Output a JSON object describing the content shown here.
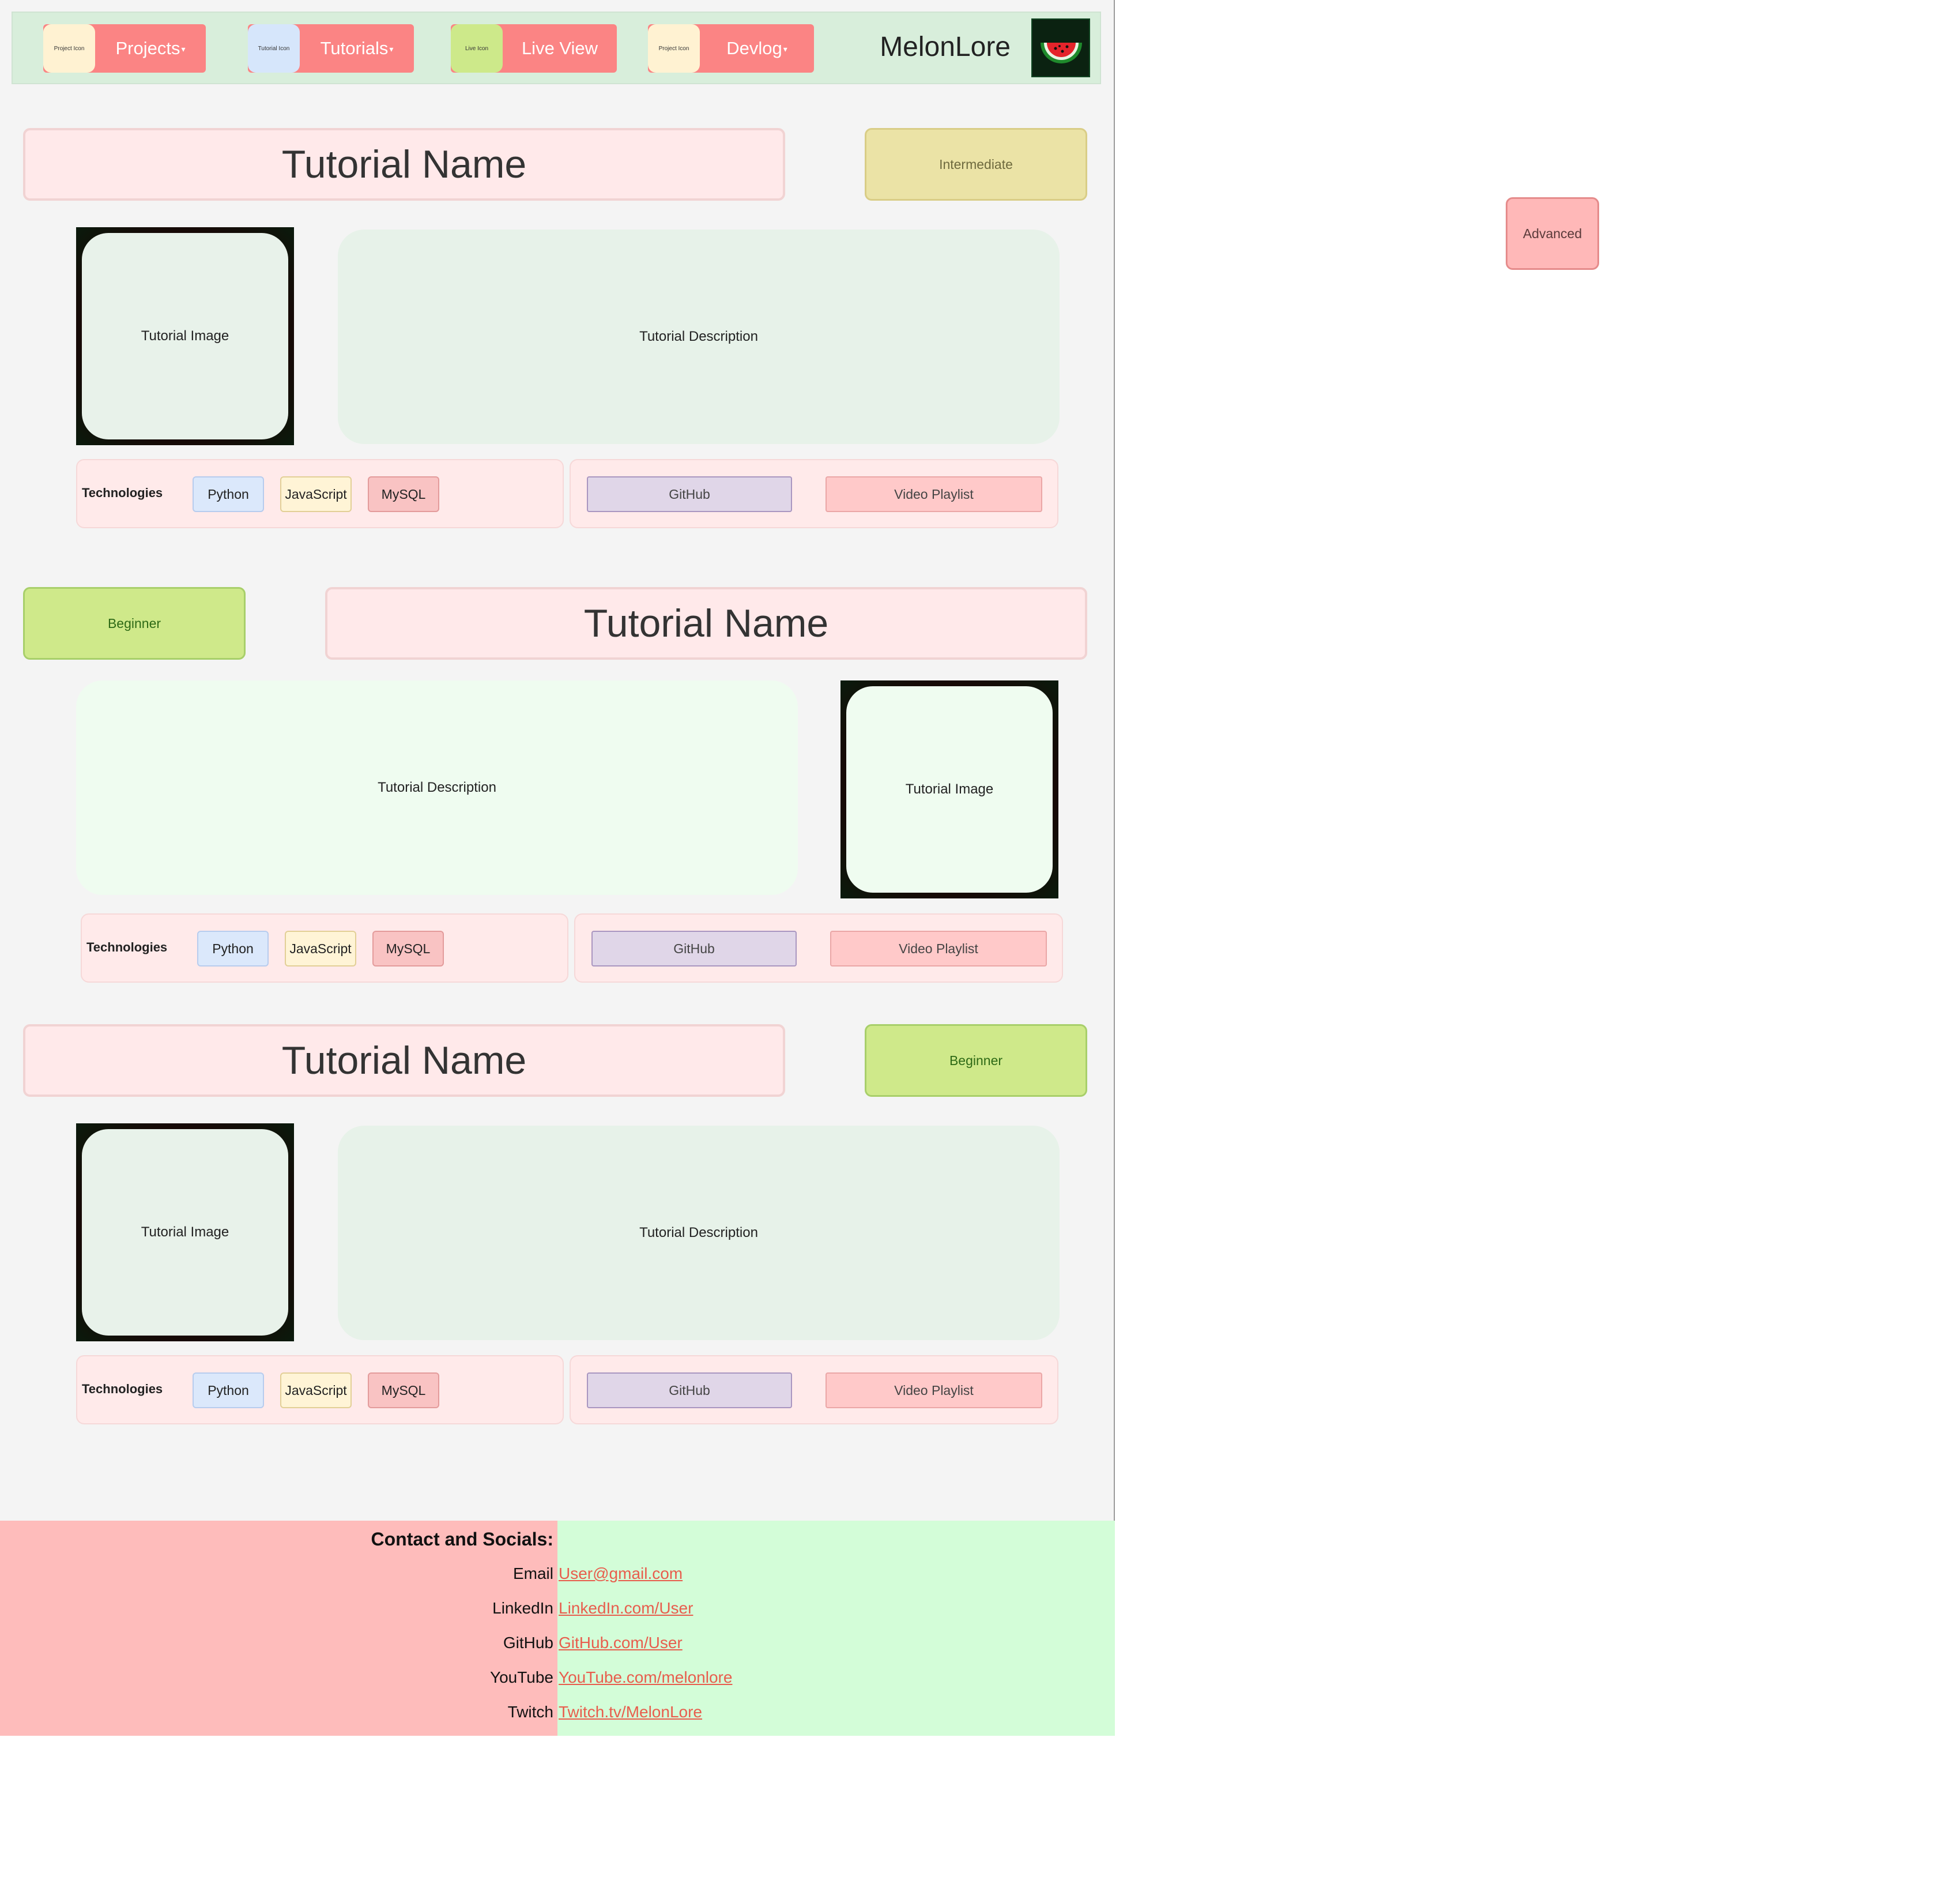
{
  "nav": {
    "items": [
      {
        "icon_text": "Project Icon",
        "label": "Projects",
        "icon_color": "#fff2d2"
      },
      {
        "icon_text": "Tutorial Icon",
        "label": "Tutorials",
        "icon_color": "#d6e6fb"
      },
      {
        "icon_text": "Live Icon",
        "label": "Live View",
        "icon_color": "#cde98a"
      },
      {
        "icon_text": "Project Icon",
        "label": "Devlog",
        "icon_color": "#fff2d2"
      }
    ],
    "brand": "MelonLore"
  },
  "tutorials": [
    {
      "title": "Tutorial Name",
      "level": "Intermediate",
      "image_label": "Tutorial Image",
      "description": "Tutorial Description",
      "technologies_label": "Technologies",
      "technologies": [
        "Python",
        "JavaScript",
        "MySQL"
      ],
      "links": [
        "GitHub",
        "Video Playlist"
      ]
    },
    {
      "title": "Tutorial Name",
      "level": "Beginner",
      "image_label": "Tutorial Image",
      "description": "Tutorial Description",
      "technologies_label": "Technologies",
      "technologies": [
        "Python",
        "JavaScript",
        "MySQL"
      ],
      "links": [
        "GitHub",
        "Video Playlist"
      ]
    },
    {
      "title": "Tutorial Name",
      "level": "Beginner",
      "image_label": "Tutorial Image",
      "description": "Tutorial Description",
      "technologies_label": "Technologies",
      "technologies": [
        "Python",
        "JavaScript",
        "MySQL"
      ],
      "links": [
        "GitHub",
        "Video Playlist"
      ]
    }
  ],
  "floating_badge": "Advanced",
  "footer": {
    "title": "Contact and Socials:",
    "contacts": [
      {
        "label": "Email",
        "value": "User@gmail.com"
      },
      {
        "label": "LinkedIn",
        "value": "LinkedIn.com/User"
      },
      {
        "label": "GitHub",
        "value": "GitHub.com/User"
      },
      {
        "label": "YouTube",
        "value": "YouTube.com/melonlore"
      },
      {
        "label": "Twitch",
        "value": "Twitch.tv/MelonLore"
      }
    ]
  },
  "colors": {
    "nav_button": "#fb8484",
    "header_bg": "#d8eedb",
    "intermediate": "#ebe3a6",
    "beginner": "#cfe98a",
    "advanced": "#ffb8b8",
    "footer_left": "#febcbb",
    "footer_right": "#d3fdd8",
    "link": "#e85d4d"
  }
}
